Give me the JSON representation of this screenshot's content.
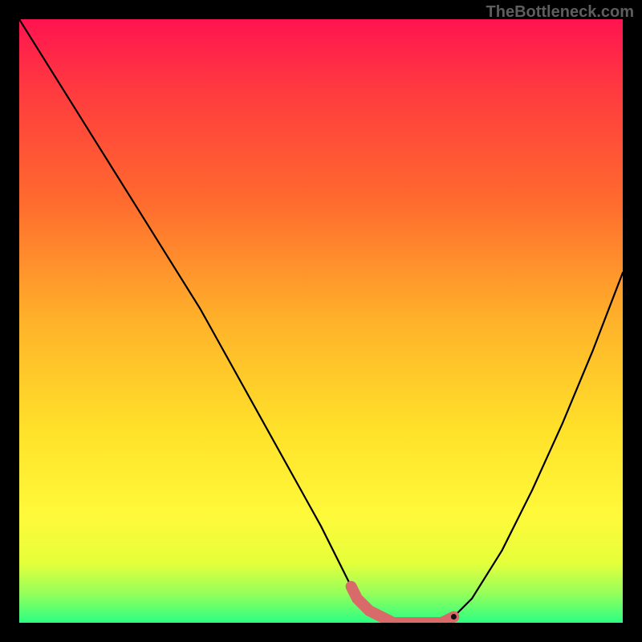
{
  "watermark": "TheBottleneck.com",
  "chart_data": {
    "type": "line",
    "title": "",
    "xlabel": "",
    "ylabel": "",
    "xlim": [
      0,
      100
    ],
    "ylim": [
      0,
      100
    ],
    "x": [
      0,
      5,
      10,
      15,
      20,
      25,
      30,
      35,
      40,
      45,
      50,
      55,
      56,
      58,
      62,
      66,
      70,
      72,
      75,
      80,
      85,
      90,
      95,
      100
    ],
    "values": [
      100,
      92,
      84,
      76,
      68,
      60,
      52,
      43,
      34,
      25,
      16,
      6,
      4,
      2,
      0,
      0,
      0,
      1,
      4,
      12,
      22,
      33,
      45,
      58
    ],
    "highlight_range_x": [
      55,
      72
    ],
    "highlight_color": "#d96a6a",
    "grid": false
  }
}
